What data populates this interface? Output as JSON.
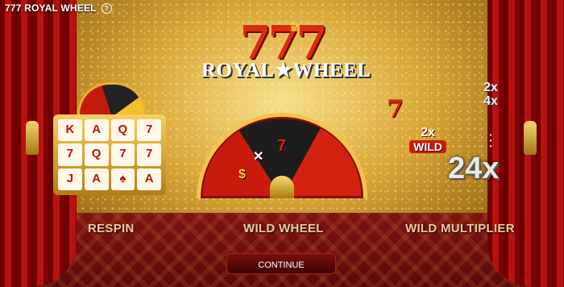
{
  "header": {
    "title": "777 ROYAL WHEEL",
    "help_icon": "?"
  },
  "logo": {
    "numbers": "777",
    "text": "ROYAL★WHEEL"
  },
  "features": {
    "respin": {
      "label": "RESPIN",
      "symbols": [
        "K",
        "A",
        "Q",
        "7",
        "7",
        "Q",
        "7",
        "7",
        "J",
        "A",
        "♠",
        "A"
      ]
    },
    "wild_wheel": {
      "label": "WILD WHEEL",
      "symbols": [
        "✕",
        "7",
        "$"
      ]
    },
    "wild_multiplier": {
      "label": "WILD MULTIPLIER",
      "seven": "7",
      "wild_multiplier": "2x",
      "wild_word": "WILD",
      "list": [
        "2x",
        "4x"
      ],
      "dots": "•\n•\n•",
      "max": "24x"
    }
  },
  "continue_label": "CONTINUE",
  "colors": {
    "accent_red": "#c81a0d",
    "gold": "#f2c44a"
  }
}
